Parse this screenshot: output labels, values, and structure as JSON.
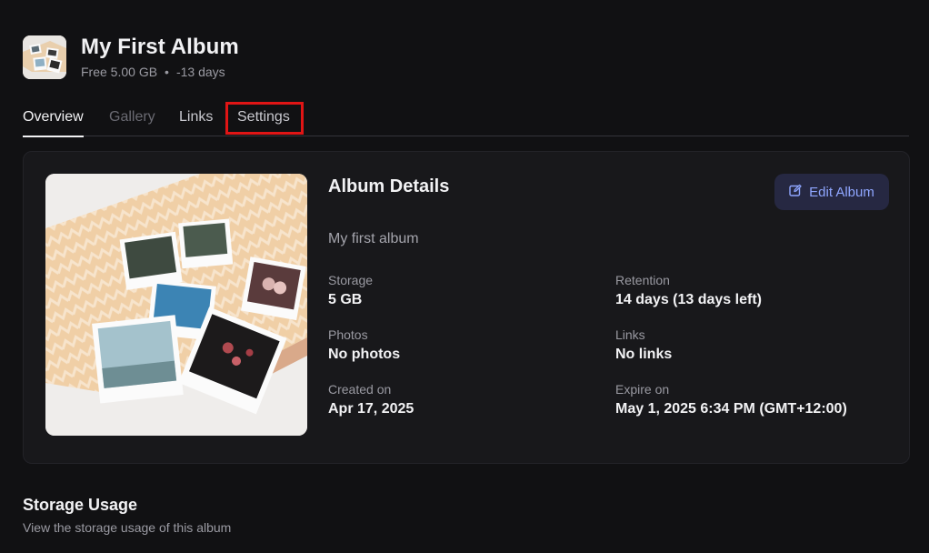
{
  "header": {
    "title": "My First Album",
    "plan": "Free 5.00 GB",
    "separator": "•",
    "days": "-13 days"
  },
  "tabs": [
    {
      "label": "Overview",
      "state": "active"
    },
    {
      "label": "Gallery",
      "state": "disabled"
    },
    {
      "label": "Links",
      "state": "normal"
    },
    {
      "label": "Settings",
      "state": "highlighted"
    }
  ],
  "details": {
    "title": "Album Details",
    "edit_button_label": "Edit Album",
    "edit_icon": "edit-icon",
    "description": "My first album",
    "fields": {
      "storage": {
        "label": "Storage",
        "value": "5 GB"
      },
      "retention": {
        "label": "Retention",
        "value": "14 days (13 days left)"
      },
      "photos": {
        "label": "Photos",
        "value": "No photos"
      },
      "links": {
        "label": "Links",
        "value": "No links"
      },
      "created": {
        "label": "Created on",
        "value": "Apr 17, 2025"
      },
      "expire": {
        "label": "Expire on",
        "value": "May 1, 2025 6:34 PM (GMT+12:00)"
      }
    }
  },
  "storage_section": {
    "title": "Storage Usage",
    "subtitle": "View the storage usage of this album"
  },
  "colors": {
    "background": "#111113",
    "card": "#18181b",
    "accent": "#8fa6ff",
    "highlight": "#e01515"
  }
}
